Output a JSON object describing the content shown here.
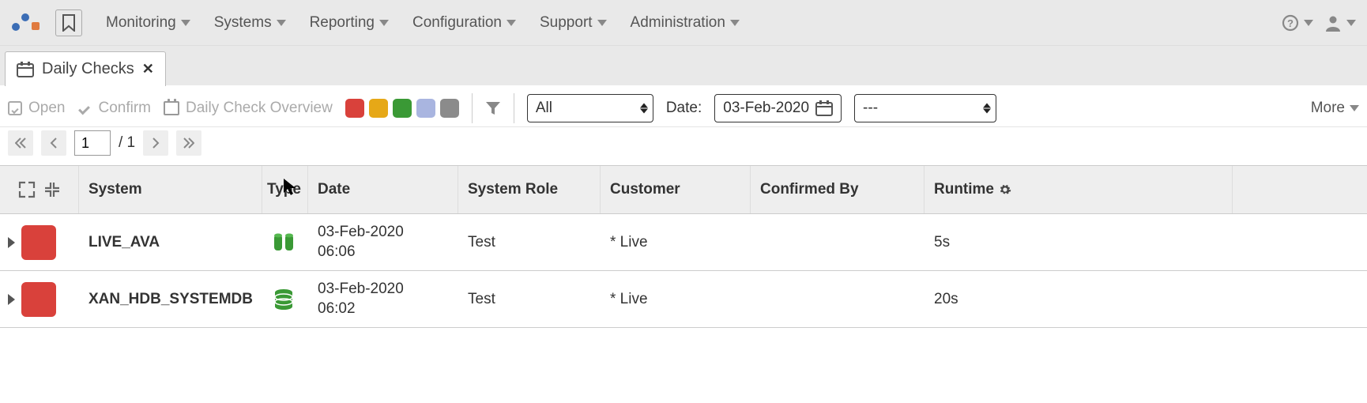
{
  "nav": {
    "items": [
      "Monitoring",
      "Systems",
      "Reporting",
      "Configuration",
      "Support",
      "Administration"
    ]
  },
  "tab": {
    "title": "Daily Checks"
  },
  "toolbar": {
    "open": "Open",
    "confirm": "Confirm",
    "overview": "Daily Check Overview",
    "filter_all": "All",
    "date_label": "Date:",
    "date_value": "03-Feb-2020",
    "range_value": "---",
    "more": "More",
    "status_colors": {
      "red": "#d9413b",
      "orange": "#e6a817",
      "green": "#3a9935",
      "bluel": "#a9b5e0",
      "gray": "#8b8b8b"
    }
  },
  "pager": {
    "current": "1",
    "total": "/ 1"
  },
  "table": {
    "headers": {
      "system": "System",
      "type": "Type",
      "date": "Date",
      "role": "System Role",
      "customer": "Customer",
      "confirmed": "Confirmed By",
      "runtime": "Runtime"
    },
    "rows": [
      {
        "system": "LIVE_AVA",
        "type": "cylinders",
        "date_line1": "03-Feb-2020",
        "date_line2": "06:06",
        "role": "Test",
        "customer": "* Live",
        "confirmed": "",
        "runtime": "5s"
      },
      {
        "system": "XAN_HDB_SYSTEMDB",
        "type": "database",
        "date_line1": "03-Feb-2020",
        "date_line2": "06:02",
        "role": "Test",
        "customer": "* Live",
        "confirmed": "",
        "runtime": "20s"
      }
    ]
  }
}
